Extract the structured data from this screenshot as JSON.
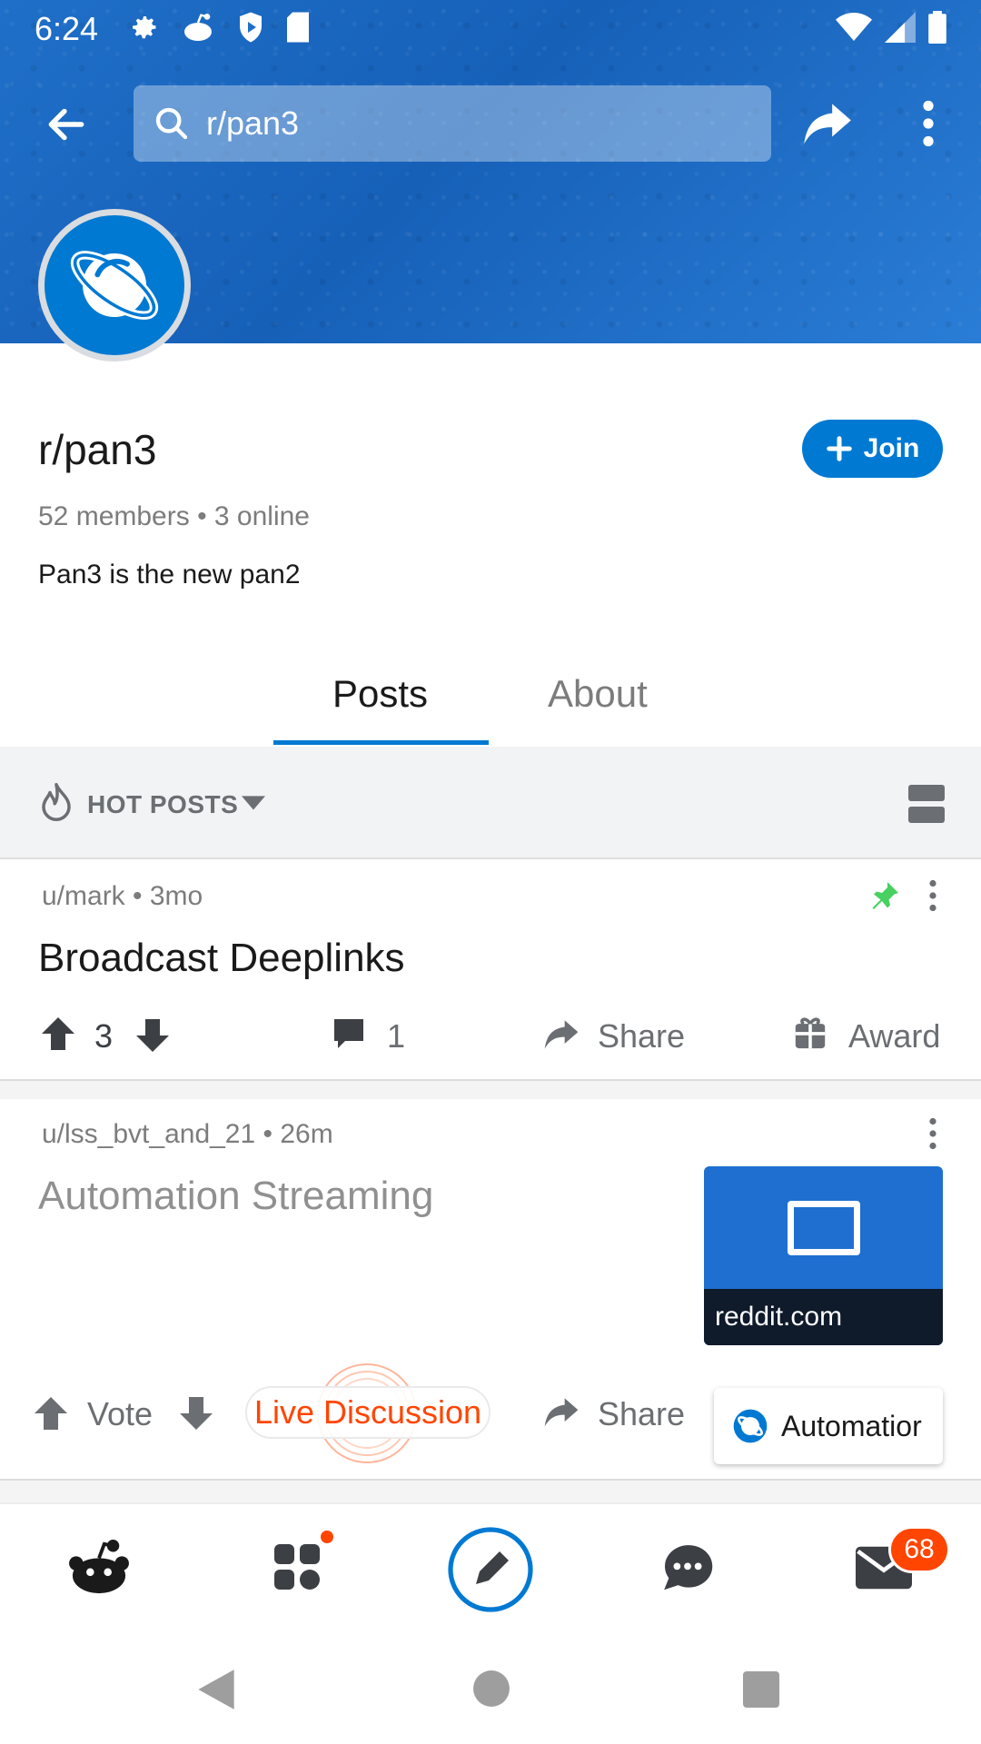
{
  "status_bar": {
    "time": "6:24"
  },
  "header": {
    "search_text": "r/pan3"
  },
  "subreddit": {
    "name": "r/pan3",
    "join_label": "Join",
    "members_line": "52 members • 3 online",
    "description": "Pan3 is the new pan2"
  },
  "tabs": [
    {
      "label": "Posts"
    },
    {
      "label": "About"
    }
  ],
  "sort": {
    "label": "HOT POSTS"
  },
  "posts": [
    {
      "meta": "u/mark • 3mo",
      "title": "Broadcast Deeplinks",
      "score": "3",
      "comments": "1",
      "share_label": "Share",
      "award_label": "Award"
    },
    {
      "meta": "u/lss_bvt_and_21 • 26m",
      "title": "Automation Streaming",
      "vote_label": "Vote",
      "live_label": "Live Discussion",
      "share_label": "Share",
      "thumb_domain": "reddit.com"
    }
  ],
  "toast": {
    "label": "Automatior"
  },
  "bottom_nav": {
    "inbox_badge": "68"
  },
  "colors": {
    "accent": "#0079d3",
    "orange": "#ff4500",
    "pin": "#46d160"
  }
}
